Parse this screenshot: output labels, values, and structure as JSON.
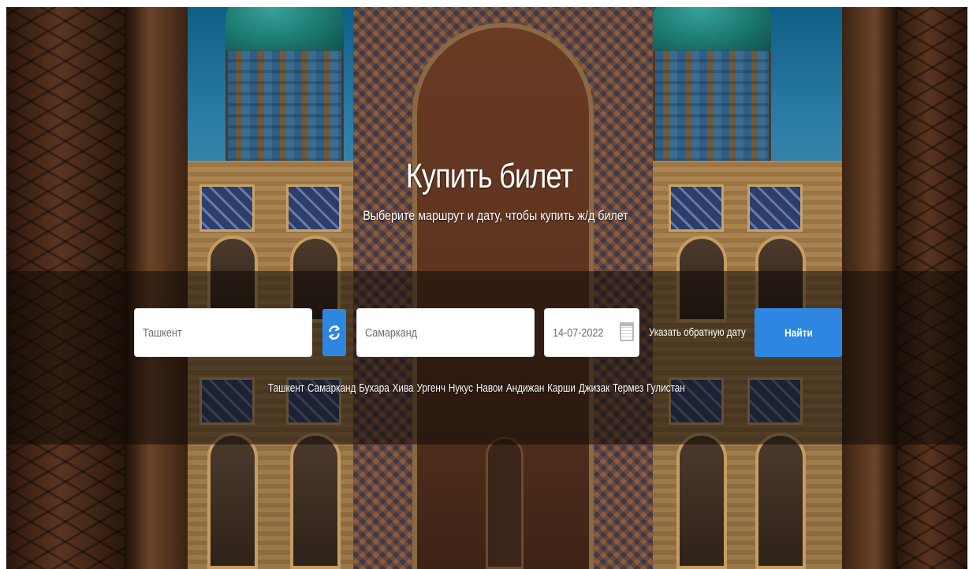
{
  "hero": {
    "title": "Купить билет",
    "subtitle": "Выберите маршрут и дату, чтобы купить ж/д билет"
  },
  "search_form": {
    "from_value": "Ташкент",
    "to_value": "Самарканд",
    "date_value": "14-07-2022",
    "return_date_label": "Указать обратную дату",
    "search_button_label": "Найти",
    "swap_icon": "refresh-icon",
    "calendar_icon": "calendar-icon"
  },
  "cities": [
    "Ташкент",
    "Самарканд",
    "Бухара",
    "Хива",
    "Ургенч",
    "Нукус",
    "Навои",
    "Андижан",
    "Карши",
    "Джизак",
    "Термез",
    "Гулистан"
  ],
  "colors": {
    "accent": "#2f86e0",
    "text_on_image": "#ffffff"
  }
}
